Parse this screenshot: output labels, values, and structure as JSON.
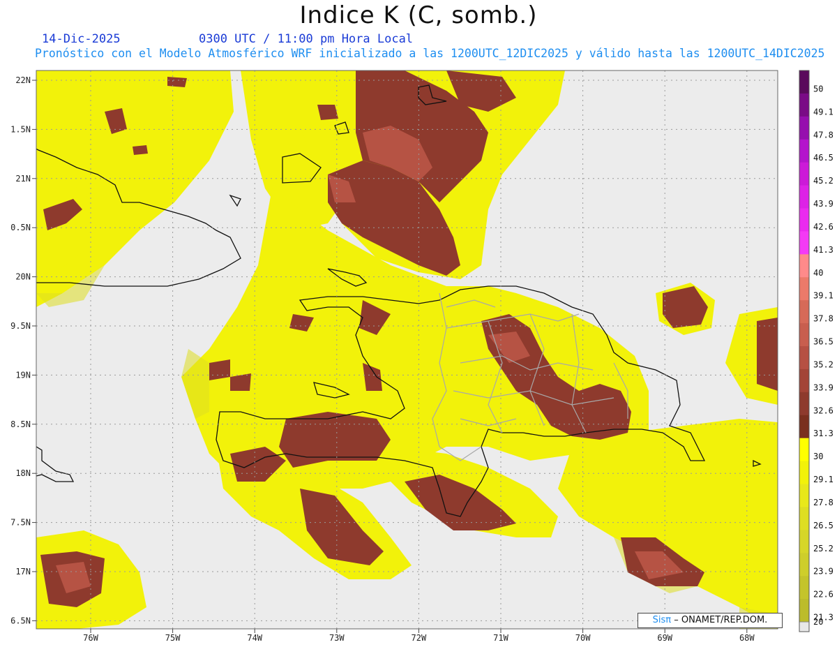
{
  "header": {
    "title": "Indice K (C, somb.)",
    "date": "14-Dic-2025",
    "time": "0300 UTC / 11:00 pm Hora Local",
    "subtitle": "Pronóstico con el Modelo Atmosférico WRF inicializado a las 1200UTC_12DIC2025 y válido hasta las  1200UTC_14DIC2025"
  },
  "axes": {
    "lat_labels": [
      "22N",
      "1.5N",
      "21N",
      "0.5N",
      "20N",
      "9.5N",
      "19N",
      "8.5N",
      "18N",
      "7.5N",
      "17N",
      "6.5N"
    ],
    "lon_labels": [
      "76W",
      "75W",
      "74W",
      "73W",
      "72W",
      "71W",
      "70W",
      "69W",
      "68W"
    ]
  },
  "colorbar": {
    "labels": [
      "50",
      "49.1",
      "47.8",
      "46.5",
      "45.2",
      "43.9",
      "42.6",
      "41.3",
      "40",
      "39.1",
      "37.8",
      "36.5",
      "35.2",
      "33.9",
      "32.6",
      "31.3",
      "30",
      "29.1",
      "27.8",
      "26.5",
      "25.2",
      "23.9",
      "22.6",
      "21.3",
      "20"
    ],
    "colors": [
      "#5a0a5c",
      "#7a0b86",
      "#960fae",
      "#b414cc",
      "#cc1ad8",
      "#dd22e6",
      "#ea2aef",
      "#f43af5",
      "#ff8a8a",
      "#ec7a6a",
      "#d66a58",
      "#c85e4e",
      "#b65043",
      "#a34437",
      "#8e3a2d",
      "#7a2f1e",
      "#ffff00",
      "#f2f20a",
      "#e8e81a",
      "#dede22",
      "#d6d628",
      "#cece2a",
      "#c4c42a",
      "#bcbc2a"
    ]
  },
  "credit": {
    "sis": "Sisπ",
    "org": "– ONAMET/REP.DOM."
  }
}
